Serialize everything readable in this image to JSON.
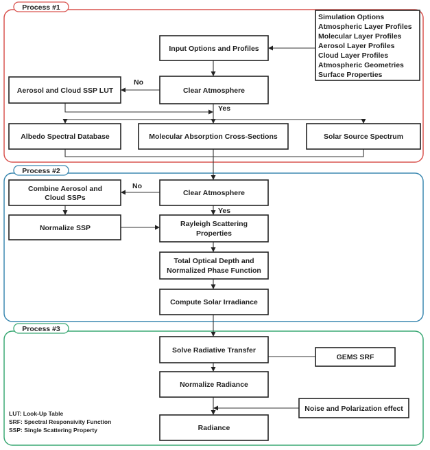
{
  "colors": {
    "process1": "#d9534f",
    "process2": "#3b88b0",
    "process3": "#3aa874",
    "box_stroke": "#222222"
  },
  "process1": {
    "label": "Process #1",
    "inputs_list": [
      "Simulation Options",
      "Atmospheric Layer Profiles",
      "Molecular Layer Profiles",
      "Aerosol Layer Profiles",
      "Cloud Layer Profiles",
      "Atmospheric Geometries",
      "Surface Properties"
    ],
    "input_options": "Input Options and Profiles",
    "clear_atmosphere": "Clear Atmosphere",
    "aerosol_lut": "Aerosol and Cloud SSP LUT",
    "no": "No",
    "yes": "Yes",
    "albedo": "Albedo Spectral Database",
    "molecular": "Molecular Absorption Cross-Sections",
    "solar_source": "Solar Source Spectrum"
  },
  "process2": {
    "label": "Process #2",
    "clear_atmosphere": "Clear Atmosphere",
    "combine": [
      "Combine Aerosol and",
      "Cloud SSPs"
    ],
    "no": "No",
    "yes": "Yes",
    "normalize_ssp": "Normalize SSP",
    "rayleigh": [
      "Rayleigh Scattering",
      "Properties"
    ],
    "optical_depth": [
      "Total Optical Depth and",
      "Normalized Phase Function"
    ],
    "solar_irradiance": "Compute Solar Irradiance"
  },
  "process3": {
    "label": "Process #3",
    "solve": "Solve Radiative Transfer",
    "gems_srf": "GEMS SRF",
    "normalize_radiance": "Normalize Radiance",
    "noise": "Noise and Polarization effect",
    "radiance": "Radiance"
  },
  "legend": [
    "LUT: Look-Up Table",
    "SRF: Spectral Responsivity Function",
    "SSP: Single Scattering Property"
  ]
}
